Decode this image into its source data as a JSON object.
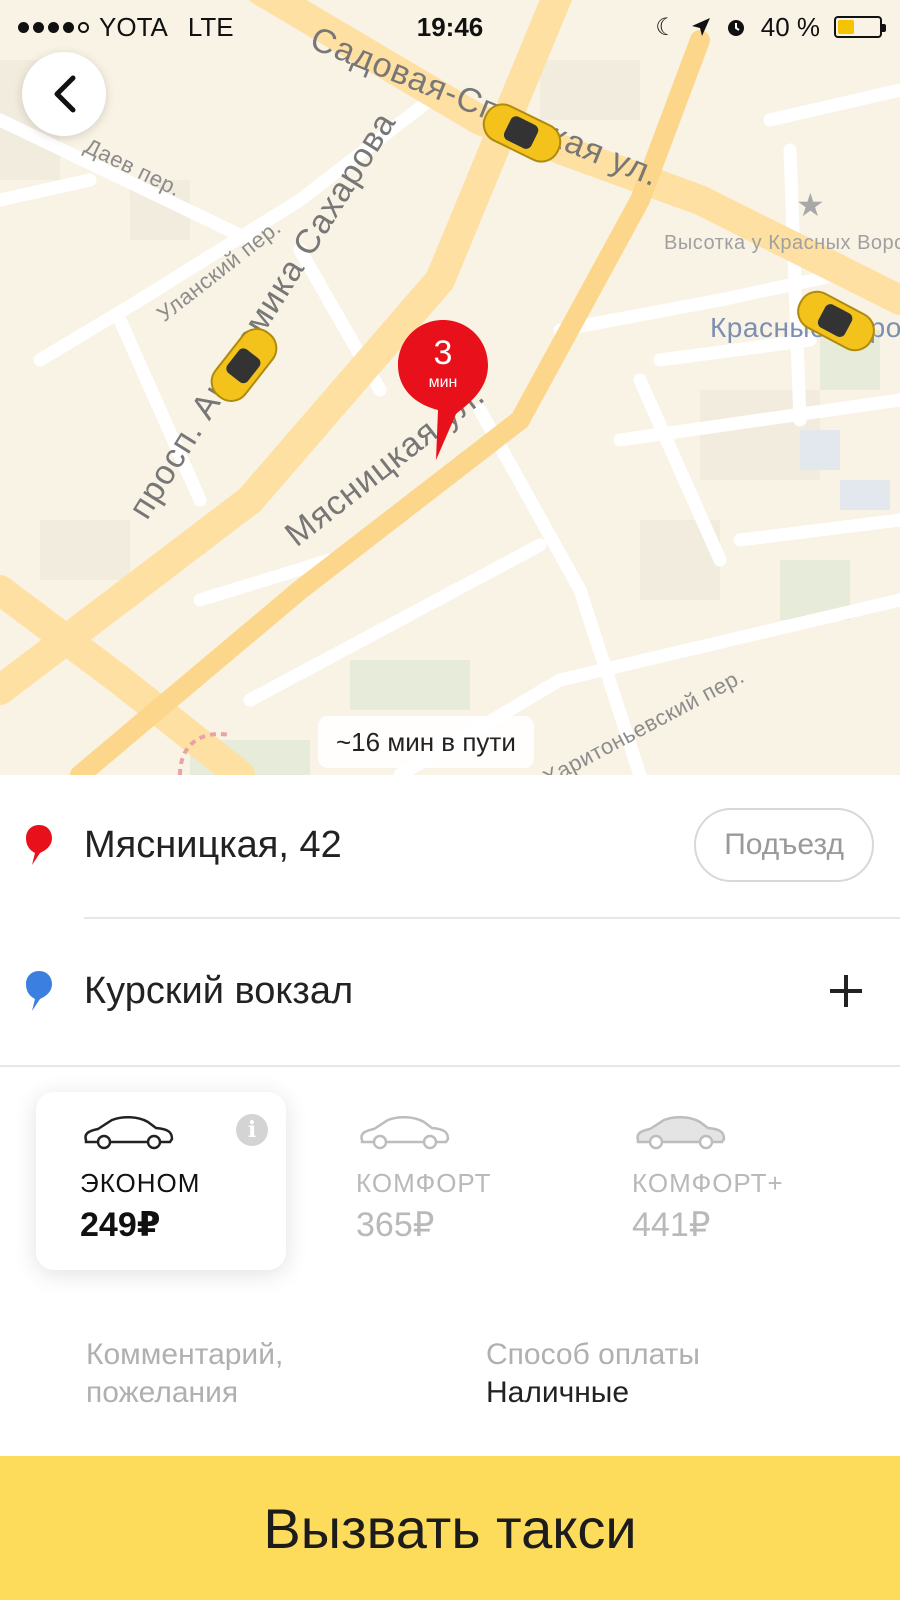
{
  "status_bar": {
    "carrier": "YOTA",
    "network": "LTE",
    "time": "19:46",
    "battery": "40 %",
    "battery_level": 0.4
  },
  "map": {
    "streets": {
      "sadovaya": "Садовая-Спасская ул.",
      "sakharova": "просп. Академика Сахарова",
      "myasnitskaya": "Мясницкая ул.",
      "daev": "Даев пер.",
      "ulansky": "Уланский пер.",
      "kharitonevsky": "Б. Харитоньевский пер."
    },
    "poi": {
      "vysotka": "Высотка у Красных Ворот",
      "krasnye_vorota": "Красные Ворота"
    },
    "eta_value": "3",
    "eta_unit": "мин",
    "trip_duration": "~16 мин в пути"
  },
  "route": {
    "from": "Мясницкая, 42",
    "entrance_label": "Подъезд",
    "to": "Курский вокзал"
  },
  "tariffs": [
    {
      "name": "ЭКОНОМ",
      "price": "249₽"
    },
    {
      "name": "КОМФОРТ",
      "price": "365₽"
    },
    {
      "name": "КОМФОРТ+",
      "price": "441₽"
    }
  ],
  "options": {
    "comment_label": "Комментарий, пожелания",
    "payment_label": "Способ оплаты",
    "payment_value": "Наличные"
  },
  "call_button_label": "Вызвать такси",
  "colors": {
    "accent_yellow": "#fedc5b",
    "pin_red": "#e8101b",
    "pin_blue": "#3b7fe0",
    "map_bg": "#f9f3e6"
  }
}
